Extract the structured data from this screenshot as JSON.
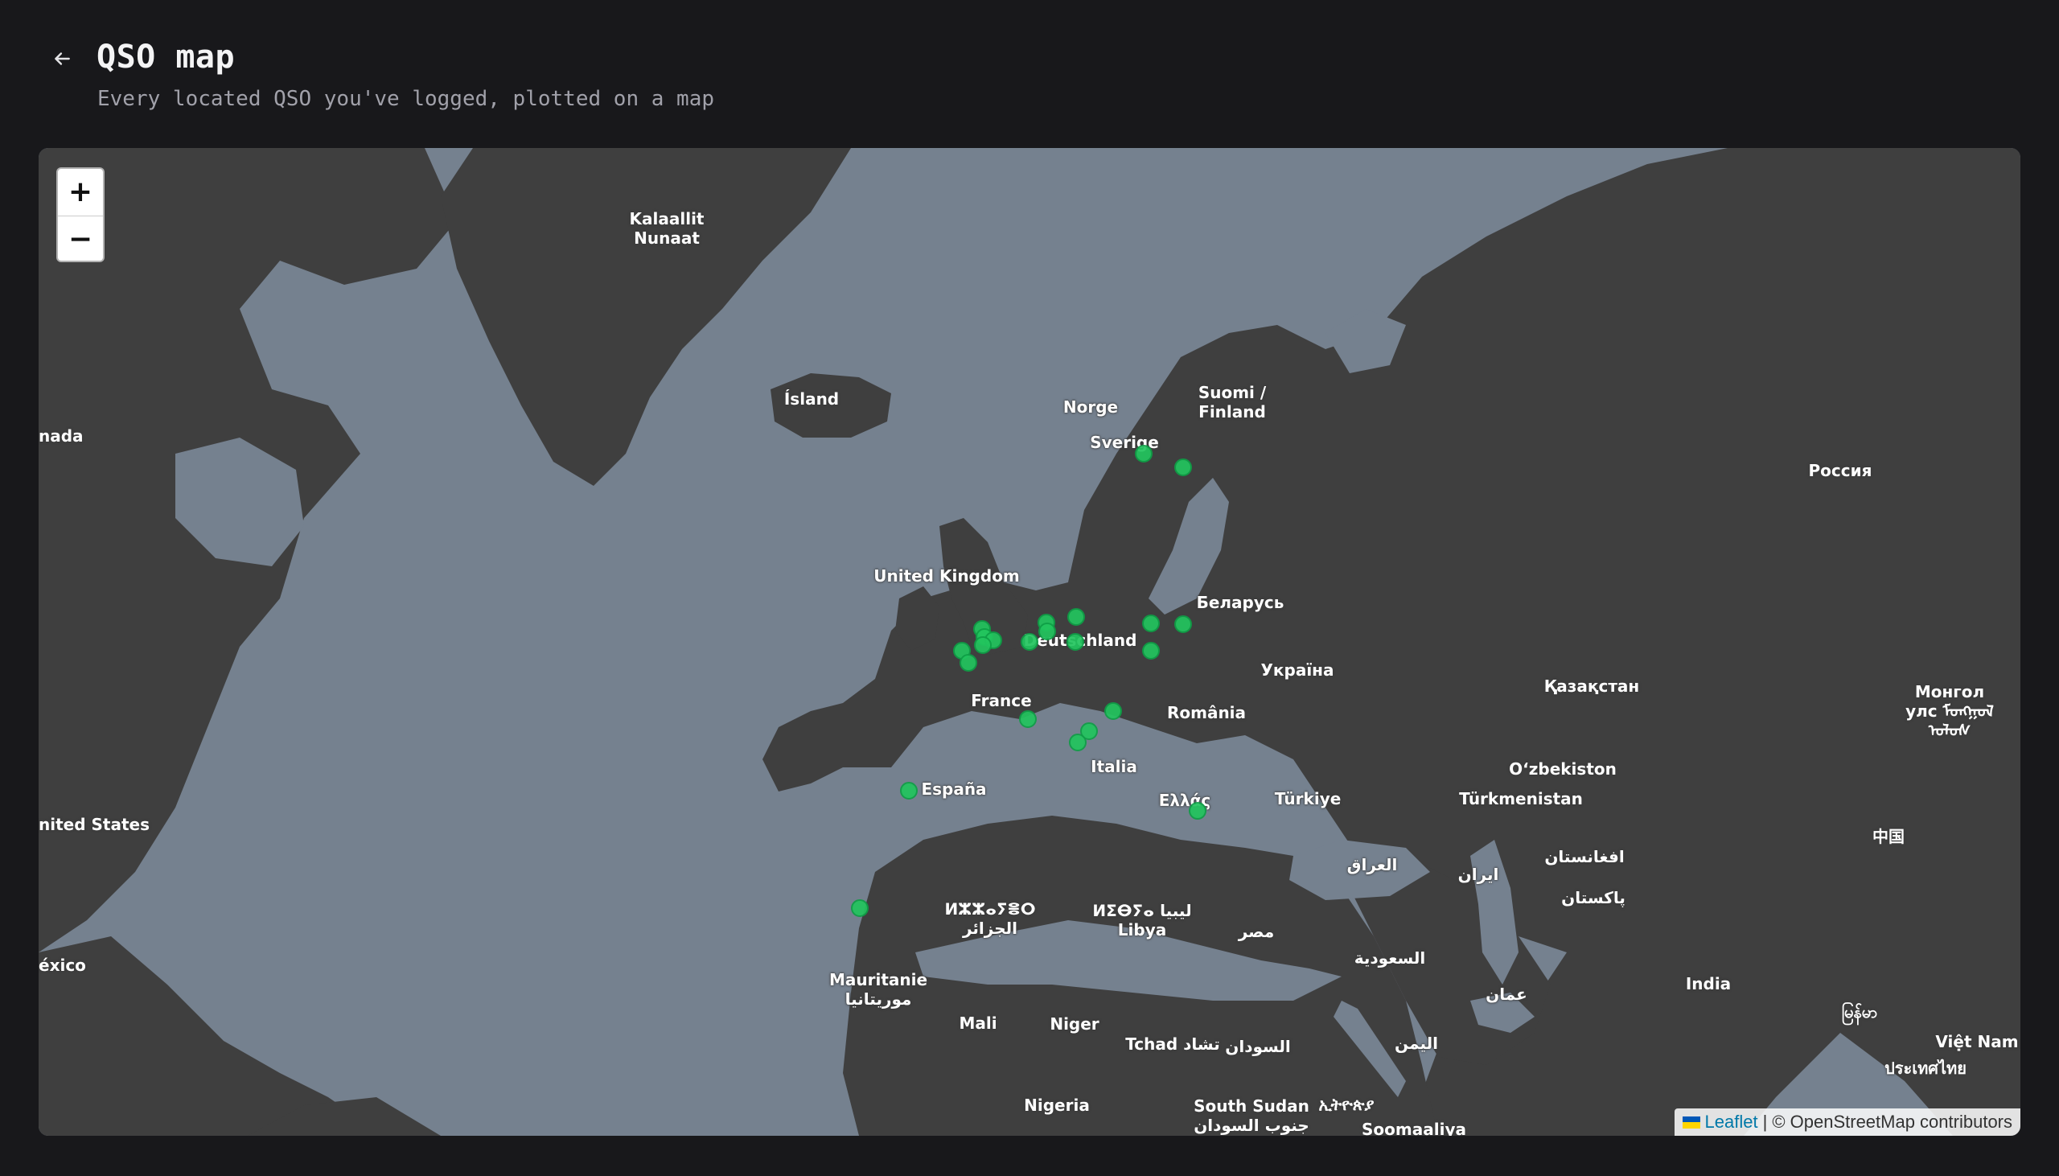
{
  "header": {
    "back_icon": "arrow-left-icon",
    "title": "QSO map",
    "subtitle": "Every located QSO you've logged, plotted on a map"
  },
  "map": {
    "zoom_in_label": "+",
    "zoom_out_label": "−",
    "attribution": {
      "flag_icon": "ukraine-flag-icon",
      "flag_colors": [
        "#0057b7",
        "#ffd500"
      ],
      "link": "Leaflet",
      "link_color": "#0078a8",
      "separator": "|",
      "text": "© OpenStreetMap contributors"
    },
    "colors": {
      "water": "#75818f",
      "land": "#3f3f3f",
      "marker": "#22c55e"
    },
    "labels": [
      {
        "text": "Kalaallit\nNunaat"
      },
      {
        "text": "Ísland"
      },
      {
        "text": "Norge"
      },
      {
        "text": "Suomi /\nFinland"
      },
      {
        "text": "Sverige"
      },
      {
        "text": "Россия"
      },
      {
        "text": "nada"
      },
      {
        "text": "United Kingdom"
      },
      {
        "text": "Беларусь"
      },
      {
        "text": "Deutschland"
      },
      {
        "text": "Україна"
      },
      {
        "text": "France"
      },
      {
        "text": "România"
      },
      {
        "text": "Қазақстан"
      },
      {
        "text": "Монгол\nулс ᠮᠣᠩᠭᠣᠯ\nᠤᠯᠤᠰ"
      },
      {
        "text": "Italia"
      },
      {
        "text": "O‘zbekiston"
      },
      {
        "text": "España"
      },
      {
        "text": "Ελλάς"
      },
      {
        "text": "Türkiye"
      },
      {
        "text": "Türkmenistan"
      },
      {
        "text": "nited States"
      },
      {
        "text": "中国"
      },
      {
        "text": "العراق"
      },
      {
        "text": "ایران"
      },
      {
        "text": "افغانستان"
      },
      {
        "text": "پاکستان"
      },
      {
        "text": "ⵍⵣⵣⴰⵢⴻⵔ\nالجزائر"
      },
      {
        "text": "ⵍⵉⴱⵢⴰ ليبيا\nLibya"
      },
      {
        "text": "مصر"
      },
      {
        "text": "éxico"
      },
      {
        "text": "السعودية"
      },
      {
        "text": "Mauritanie\nموريتانيا"
      },
      {
        "text": "India"
      },
      {
        "text": "عمان"
      },
      {
        "text": "မြန်မာ"
      },
      {
        "text": "Việt Nam"
      },
      {
        "text": "Mali"
      },
      {
        "text": "Niger"
      },
      {
        "text": "Tchad تشاد"
      },
      {
        "text": "السودان"
      },
      {
        "text": "اليمن"
      },
      {
        "text": "ประเทศไทย"
      },
      {
        "text": "Nigeria"
      },
      {
        "text": "South Sudan\nجنوب السودان"
      },
      {
        "text": "ኢትዮጵያ"
      },
      {
        "text": "Soomaaliya"
      }
    ]
  }
}
